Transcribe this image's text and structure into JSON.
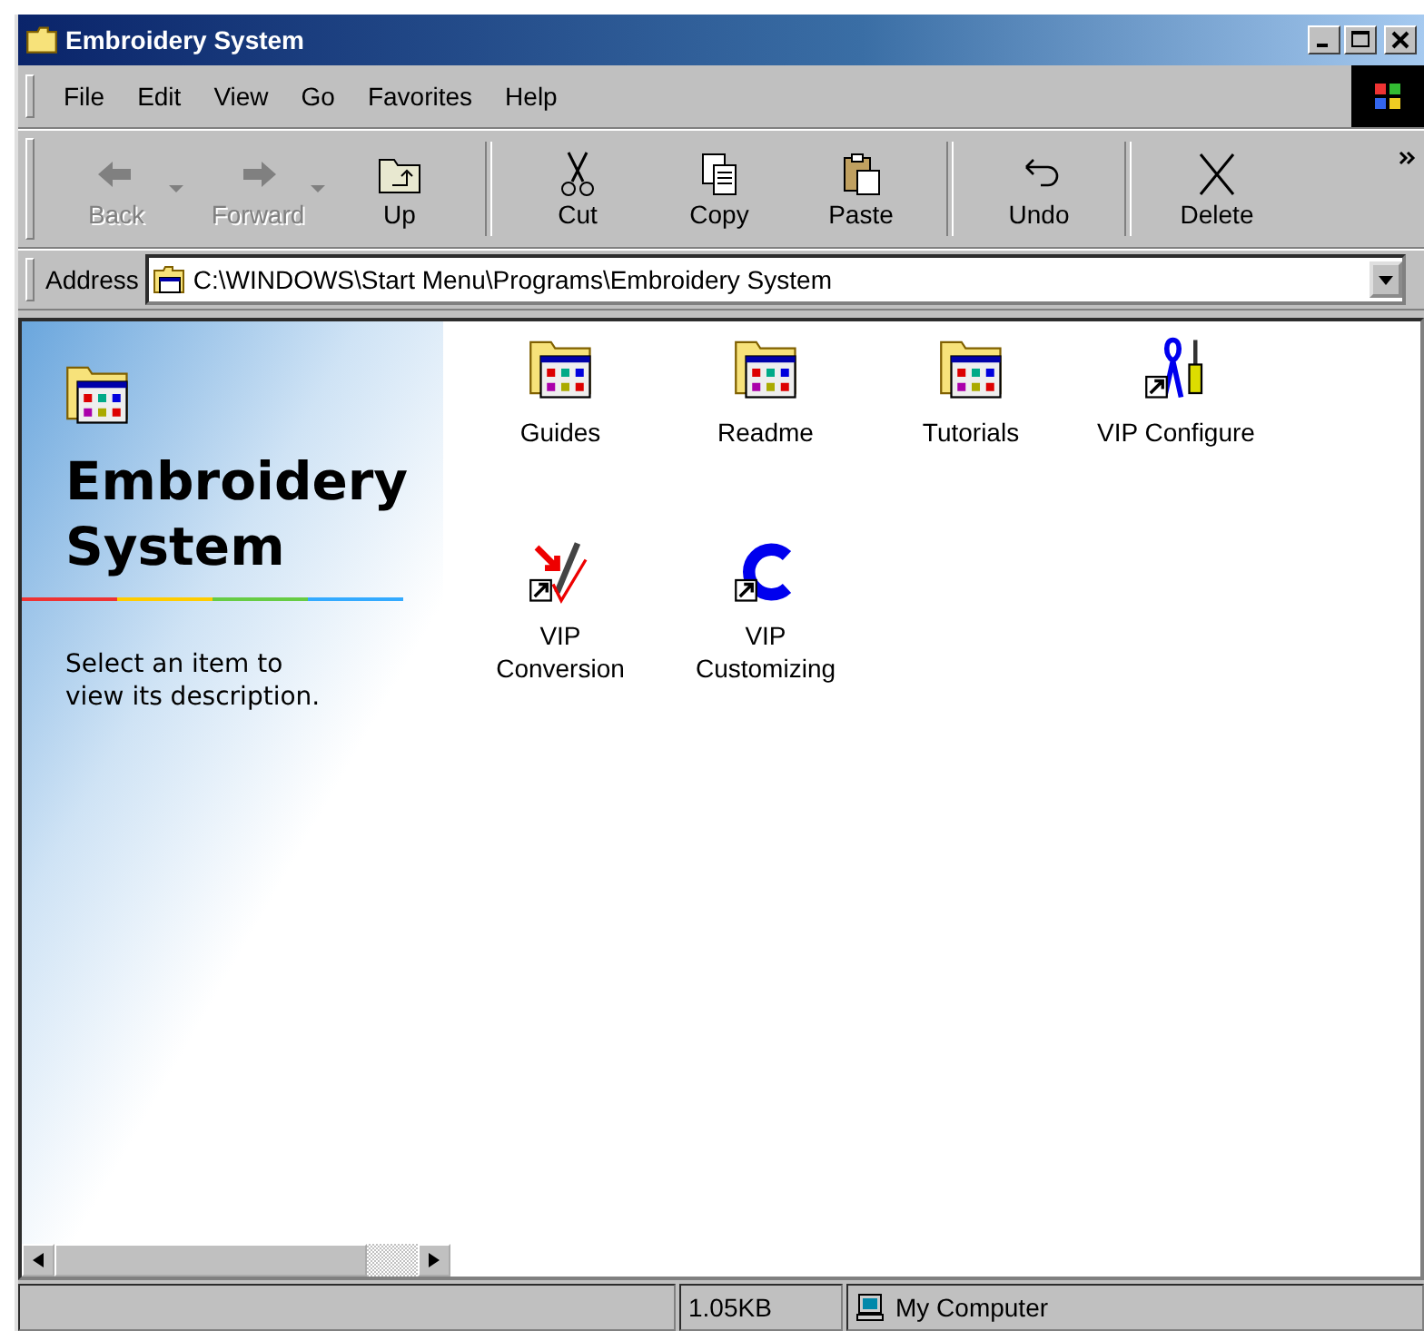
{
  "window": {
    "title": "Embroidery System"
  },
  "menu": [
    "File",
    "Edit",
    "View",
    "Go",
    "Favorites",
    "Help"
  ],
  "toolbar": [
    {
      "kind": "back",
      "label": "Back",
      "disabled": true,
      "dropdown": true
    },
    {
      "kind": "forward",
      "label": "Forward",
      "disabled": true,
      "dropdown": true
    },
    {
      "kind": "up",
      "label": "Up",
      "disabled": false,
      "dropdown": false
    },
    {
      "kind": "cut",
      "label": "Cut",
      "disabled": false,
      "dropdown": false
    },
    {
      "kind": "copy",
      "label": "Copy",
      "disabled": false,
      "dropdown": false
    },
    {
      "kind": "paste",
      "label": "Paste",
      "disabled": false,
      "dropdown": false
    },
    {
      "kind": "undo",
      "label": "Undo",
      "disabled": false,
      "dropdown": false
    },
    {
      "kind": "delete",
      "label": "Delete",
      "disabled": false,
      "dropdown": false
    }
  ],
  "address": {
    "label": "Address",
    "value": "C:\\WINDOWS\\Start Menu\\Programs\\Embroidery System"
  },
  "info_pane": {
    "title": "Embroidery System",
    "description": "Select an item to view its description."
  },
  "items": [
    {
      "kind": "folder",
      "label": "Guides"
    },
    {
      "kind": "folder",
      "label": "Readme"
    },
    {
      "kind": "folder",
      "label": "Tutorials"
    },
    {
      "kind": "tools",
      "label": "VIP Configure"
    },
    {
      "kind": "conversion",
      "label": "VIP Conversion"
    },
    {
      "kind": "letter",
      "label": "VIP Customizing"
    }
  ],
  "status_bar": {
    "size": "1.05KB",
    "zone": "My Computer"
  }
}
